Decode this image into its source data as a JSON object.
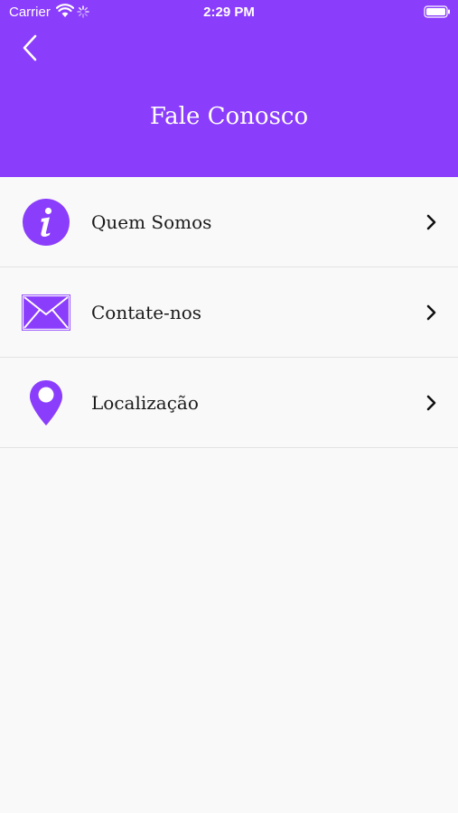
{
  "colors": {
    "accent": "#8b3dfc",
    "background": "#f9f9f9",
    "divider": "#e3e3e3"
  },
  "status_bar": {
    "carrier": "Carrier",
    "time": "2:29 PM"
  },
  "header": {
    "title": "Fale Conosco",
    "back_icon": "chevron-left-icon"
  },
  "menu": [
    {
      "label": "Quem Somos",
      "icon": "info-icon"
    },
    {
      "label": "Contate-nos",
      "icon": "envelope-icon"
    },
    {
      "label": "Localização",
      "icon": "map-pin-icon"
    }
  ]
}
